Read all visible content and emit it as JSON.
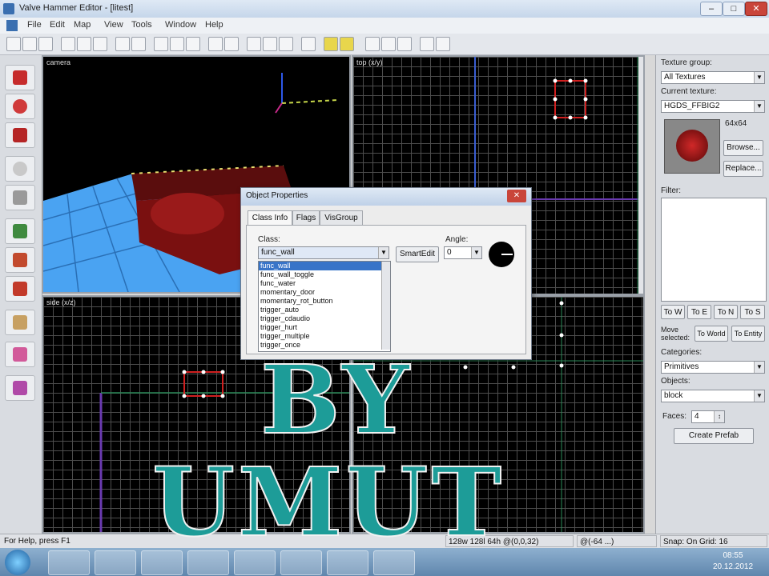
{
  "window": {
    "title": "Valve Hammer Editor - [litest]",
    "controls": {
      "minimize": "–",
      "maximize": "□",
      "close": "✕"
    }
  },
  "menu": [
    "File",
    "Edit",
    "Map",
    "View",
    "Tools",
    "Window",
    "Help"
  ],
  "viewports": {
    "camera_label": "camera",
    "top_label": "top (x/y)",
    "side_label": "side (x/z)"
  },
  "right_panel": {
    "texture_group_label": "Texture group:",
    "texture_group_value": "All Textures",
    "current_texture_label": "Current texture:",
    "current_texture_value": "HGDS_FFBIG2",
    "texture_size": "64x64",
    "browse_label": "Browse...",
    "replace_label": "Replace...",
    "filter_label": "Filter:",
    "move_selected_label": "Move selected:",
    "buttons": [
      "To W",
      "To E",
      "To N",
      "To S"
    ],
    "to_world_label": "To World",
    "to_entity_label": "To Entity",
    "categories_label": "Categories:",
    "categories_value": "Primitives",
    "objects_label": "Objects:",
    "objects_value": "block",
    "faces_label": "Faces:",
    "faces_value": "4",
    "create_prefab_label": "Create Prefab"
  },
  "dialog": {
    "title": "Object Properties",
    "tabs": [
      "Class Info",
      "Flags",
      "VisGroup"
    ],
    "class_label": "Class:",
    "class_value": "func_wall",
    "smartedit_label": "SmartEdit",
    "angle_label": "Angle:",
    "angle_value": "0",
    "class_list": [
      "func_wall",
      "func_wall_toggle",
      "func_water",
      "momentary_door",
      "momentary_rot_button",
      "trigger_auto",
      "trigger_cdaudio",
      "trigger_hurt",
      "trigger_multiple",
      "trigger_once"
    ]
  },
  "status": {
    "help": "For Help, press F1",
    "size": "128w 128l 64h @(0,0,32)",
    "coords": "@(-64 ...)",
    "snap": "Snap: On Grid: 16"
  },
  "taskbar": {
    "clock_time": "08:55",
    "clock_date": "20.12.2012"
  },
  "watermark": {
    "line1": "BY",
    "line2": "UMUT"
  }
}
